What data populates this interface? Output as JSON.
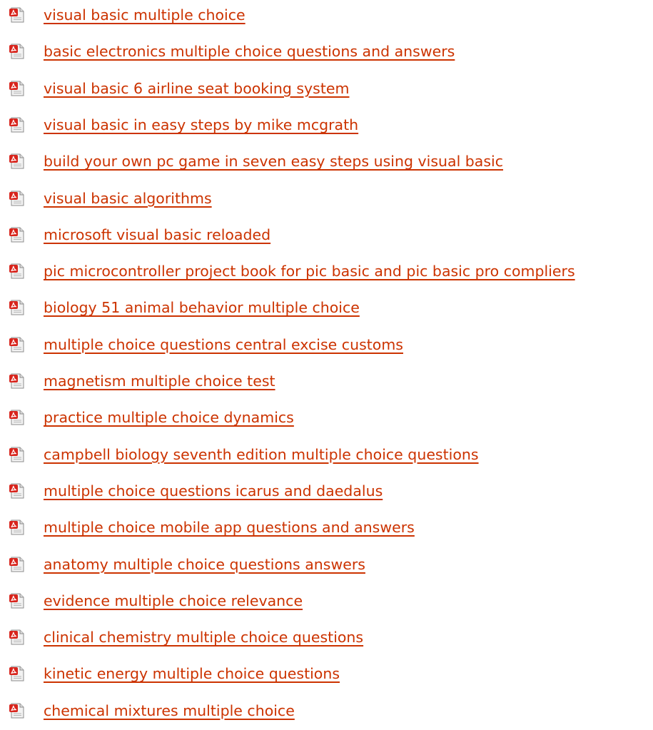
{
  "link_color": "#cc3300",
  "icon": "pdf-file-icon",
  "documents": [
    {
      "title": "visual basic multiple choice"
    },
    {
      "title": "basic electronics multiple choice questions and answers"
    },
    {
      "title": "visual basic 6 airline seat booking system"
    },
    {
      "title": "visual basic in easy steps by mike mcgrath"
    },
    {
      "title": "build your own pc game in seven easy steps using visual basic"
    },
    {
      "title": "visual basic algorithms"
    },
    {
      "title": "microsoft visual basic reloaded"
    },
    {
      "title": "pic microcontroller project book for pic basic and pic basic pro compliers"
    },
    {
      "title": "biology 51 animal behavior multiple choice"
    },
    {
      "title": "multiple choice questions central excise customs"
    },
    {
      "title": "magnetism multiple choice test"
    },
    {
      "title": "practice multiple choice dynamics"
    },
    {
      "title": "campbell biology seventh edition multiple choice questions"
    },
    {
      "title": "multiple choice questions icarus and daedalus"
    },
    {
      "title": "multiple choice mobile app questions and answers"
    },
    {
      "title": "anatomy multiple choice questions answers"
    },
    {
      "title": "evidence multiple choice relevance"
    },
    {
      "title": "clinical chemistry multiple choice questions"
    },
    {
      "title": "kinetic energy multiple choice questions"
    },
    {
      "title": "chemical mixtures multiple choice"
    }
  ]
}
